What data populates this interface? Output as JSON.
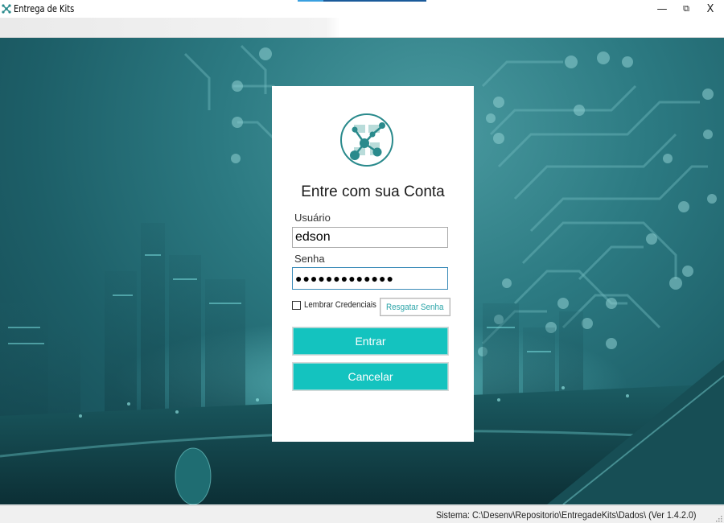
{
  "window": {
    "title": "Entrega de Kits",
    "icon": "app-network-icon",
    "controls": {
      "minimize": "—",
      "maximize": "⧉",
      "close": "X"
    }
  },
  "login": {
    "logo": "network-nodes-logo",
    "title": "Entre com sua Conta",
    "user_label": "Usuário",
    "user_value": "edson",
    "password_label": "Senha",
    "password_value": "●●●●●●●●●●●●●",
    "remember_label": "Lembrar Credenciais",
    "remember_checked": false,
    "recover_label": "Resgatar Senha",
    "enter_label": "Entrar",
    "cancel_label": "Cancelar"
  },
  "statusbar": {
    "text": "Sistema: C:\\Desenv\\Repositorio\\EntregadeKits\\Dados\\ (Ver 1.4.2.0)"
  },
  "colors": {
    "accent": "#14c3bf",
    "background": "#2c7a82",
    "logo": "#2a8a8c"
  }
}
